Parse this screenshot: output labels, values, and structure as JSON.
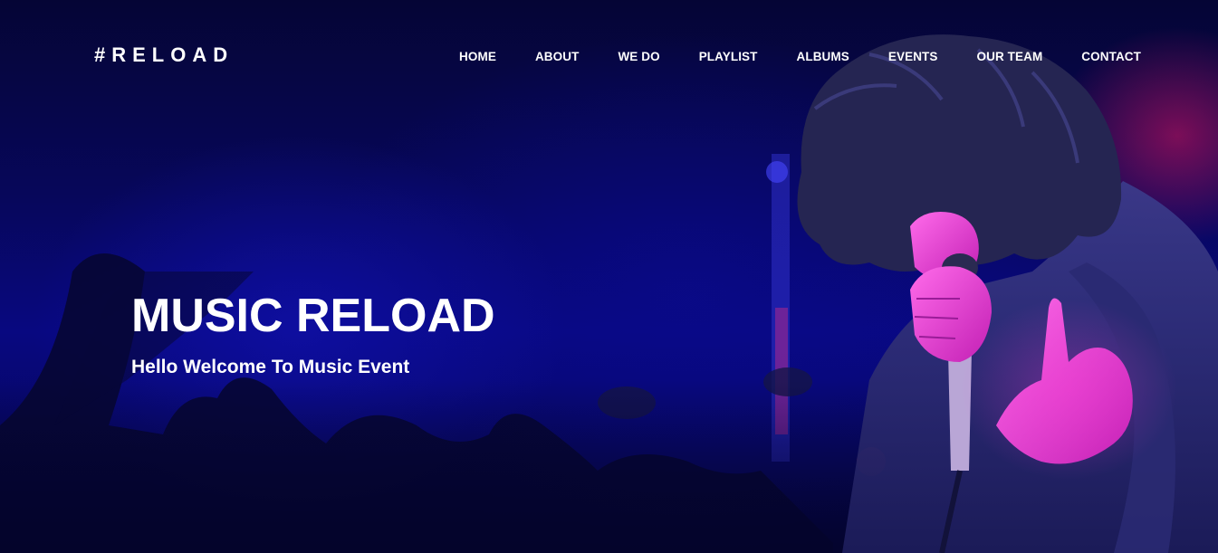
{
  "brand": {
    "logo": "#RELOAD"
  },
  "nav": {
    "items": [
      {
        "label": "HOME"
      },
      {
        "label": "ABOUT"
      },
      {
        "label": "WE DO"
      },
      {
        "label": "PLAYLIST"
      },
      {
        "label": "ALBUMS"
      },
      {
        "label": "EVENTS"
      },
      {
        "label": "OUR TEAM"
      },
      {
        "label": "CONTACT"
      }
    ]
  },
  "hero": {
    "title": "MUSIC RELOAD",
    "subtitle": "Hello Welcome To Music Event",
    "background_image": "concert-singer-photo"
  },
  "colors": {
    "background_dark": "#05052e",
    "overlay_blue": "#0a0a8c",
    "accent_magenta": "#e01ec8",
    "text": "#ffffff"
  }
}
